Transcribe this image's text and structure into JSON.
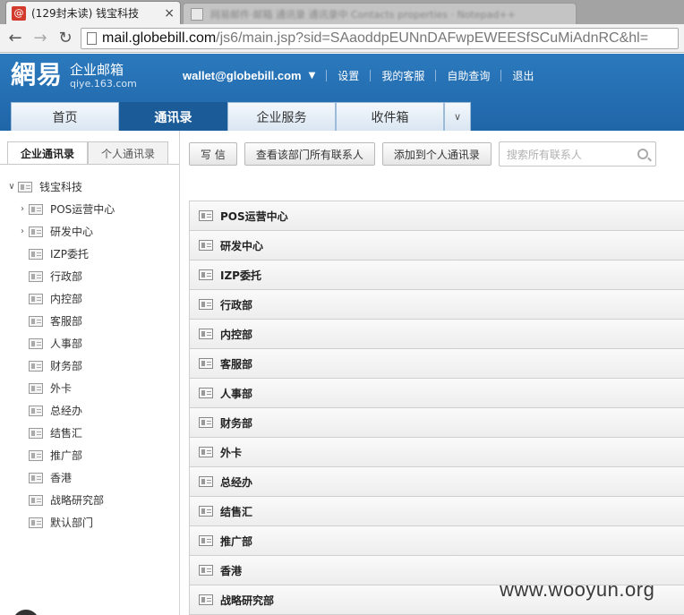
{
  "browser": {
    "active_tab_title": "(129封未读) 钱宝科技",
    "inactive_tab_title": "网易邮件·邮箱 通讯录 通讯录中 Contacts properties · Notepad++",
    "url_host": "mail.globebill.com",
    "url_rest": "/js6/main.jsp?sid=SAaoddpEUNnDAFwpEWEESfSCuMiAdnRC&hl="
  },
  "brand": {
    "mark": "網易",
    "product": "企业邮箱",
    "domain": "qiye.163.com"
  },
  "topnav": {
    "account": "wallet@globebill.com",
    "links": [
      "设置",
      "我的客服",
      "自助查询",
      "退出"
    ]
  },
  "main_tabs": [
    "首页",
    "通讯录",
    "企业服务",
    "收件箱"
  ],
  "sidebar": {
    "tabs": [
      "企业通讯录",
      "个人通讯录"
    ],
    "root": "钱宝科技",
    "children": [
      "POS运营中心",
      "研发中心",
      "IZP委托",
      "行政部",
      "内控部",
      "客服部",
      "人事部",
      "财务部",
      "外卡",
      "总经办",
      "结售汇",
      "推广部",
      "香港",
      "战略研究部",
      "默认部门"
    ]
  },
  "actions": {
    "write": "写 信",
    "view_all": "查看该部门所有联系人",
    "add_personal": "添加到个人通讯录",
    "search_placeholder": "搜索所有联系人"
  },
  "departments": [
    "POS运营中心",
    "研发中心",
    "IZP委托",
    "行政部",
    "内控部",
    "客服部",
    "人事部",
    "财务部",
    "外卡",
    "总经办",
    "结售汇",
    "推广部",
    "香港",
    "战略研究部"
  ],
  "watermark": "www.wooyun.org",
  "colors": {
    "header_blue": "#2b79bd",
    "active_tab": "#1b5b98",
    "favicon_red": "#d23a2b"
  }
}
